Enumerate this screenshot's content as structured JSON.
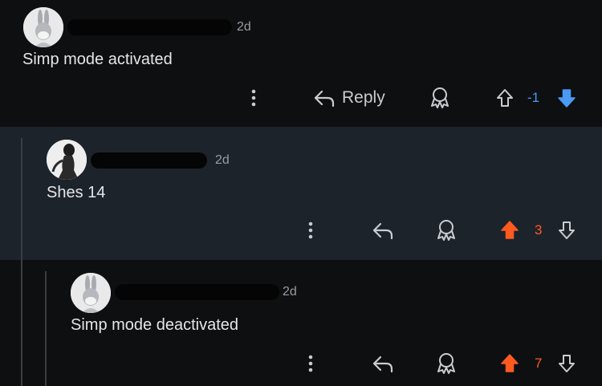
{
  "comments": [
    {
      "id": "c1",
      "avatar": "bugs-bunny-avatar",
      "time": "2d",
      "text": "Simp mode activated",
      "reply_label": "Reply",
      "score": "-1",
      "vote_state": "downvoted",
      "score_color": "#4a9af5"
    },
    {
      "id": "c2",
      "avatar": "woman-silhouette-avatar",
      "time": "2d",
      "text": "Shes 14",
      "score": "3",
      "vote_state": "upvoted",
      "score_color": "#ff5a1f"
    },
    {
      "id": "c3",
      "avatar": "bugs-bunny-avatar",
      "time": "2d",
      "text": "Simp mode deactivated",
      "score": "7",
      "vote_state": "upvoted",
      "score_color": "#ff5a1f"
    }
  ],
  "colors": {
    "upvote": "#ff5a1f",
    "downvote": "#4a9af5",
    "icon": "#c9cbd0",
    "highlight_bg": "#1c232b"
  }
}
